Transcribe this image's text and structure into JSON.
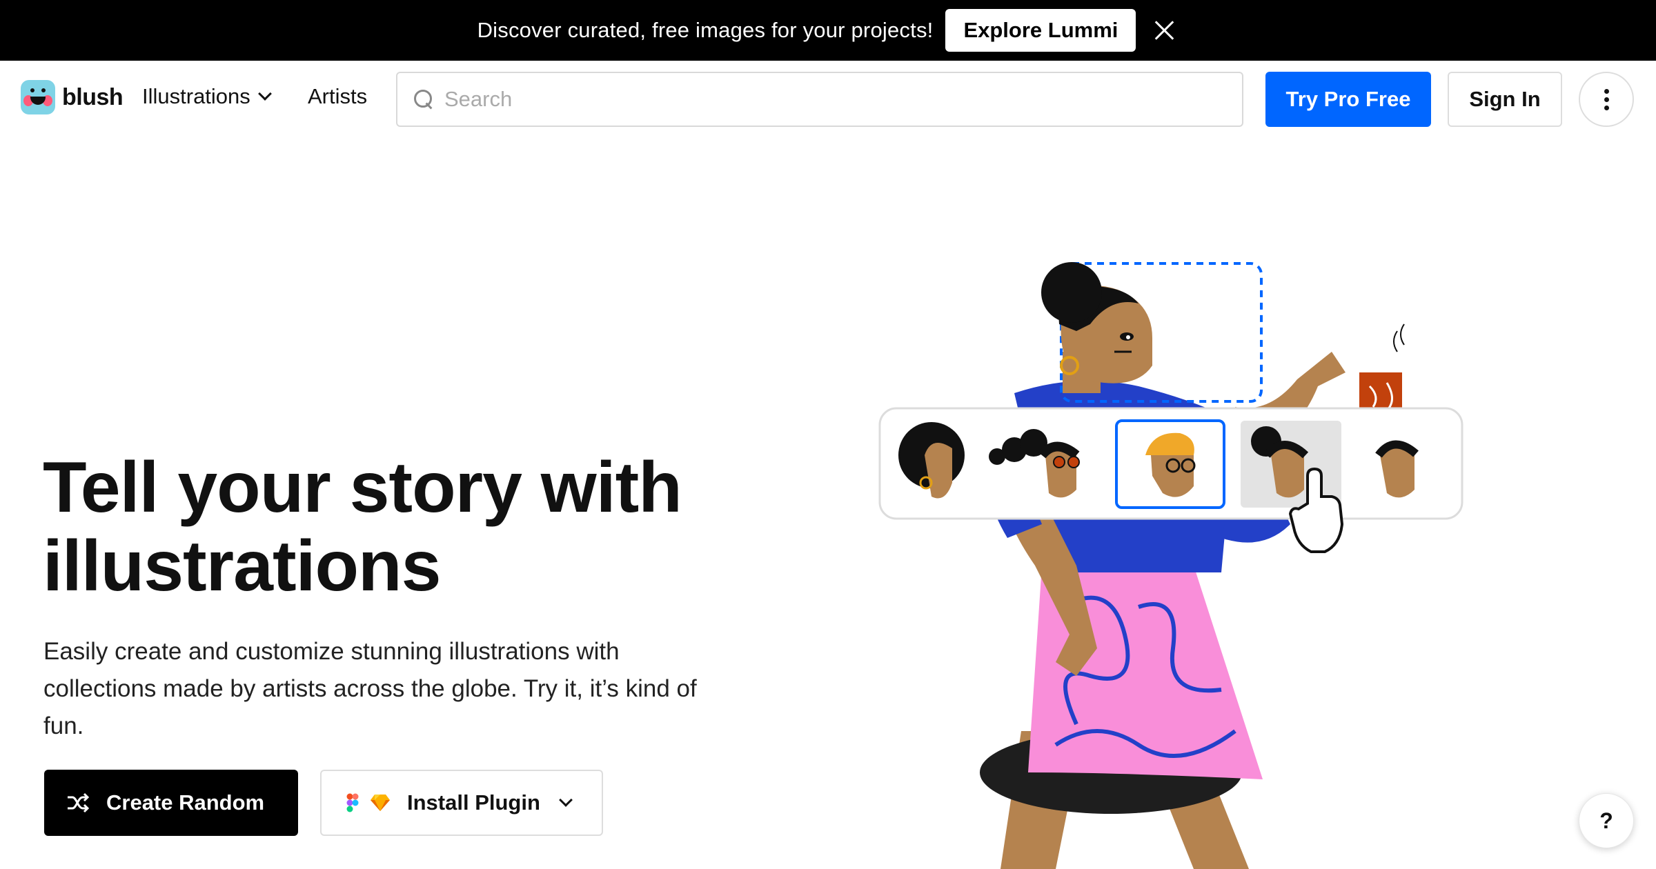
{
  "announcement": {
    "text": "Discover curated, free images for your projects!",
    "button_label": "Explore Lummi",
    "close_icon": "close-icon"
  },
  "nav": {
    "logo_text": "blush",
    "illustrations_label": "Illustrations",
    "artists_label": "Artists",
    "search_placeholder": "Search",
    "try_pro_label": "Try Pro Free",
    "sign_in_label": "Sign In",
    "more_icon": "more-vertical-icon"
  },
  "hero": {
    "title": "Tell your story with illustrations",
    "subtitle": "Easily create and customize stunning illustrations with collections made by artists across the globe. Try it, it’s kind of fun.",
    "create_random_label": "Create Random",
    "install_plugin_label": "Install Plugin"
  },
  "help": {
    "label": "?"
  },
  "colors": {
    "accent": "#0066ff",
    "announce_bg": "#000000",
    "skirt": "#f98ed9",
    "shirt": "#2340c8",
    "skin": "#b5834f"
  }
}
